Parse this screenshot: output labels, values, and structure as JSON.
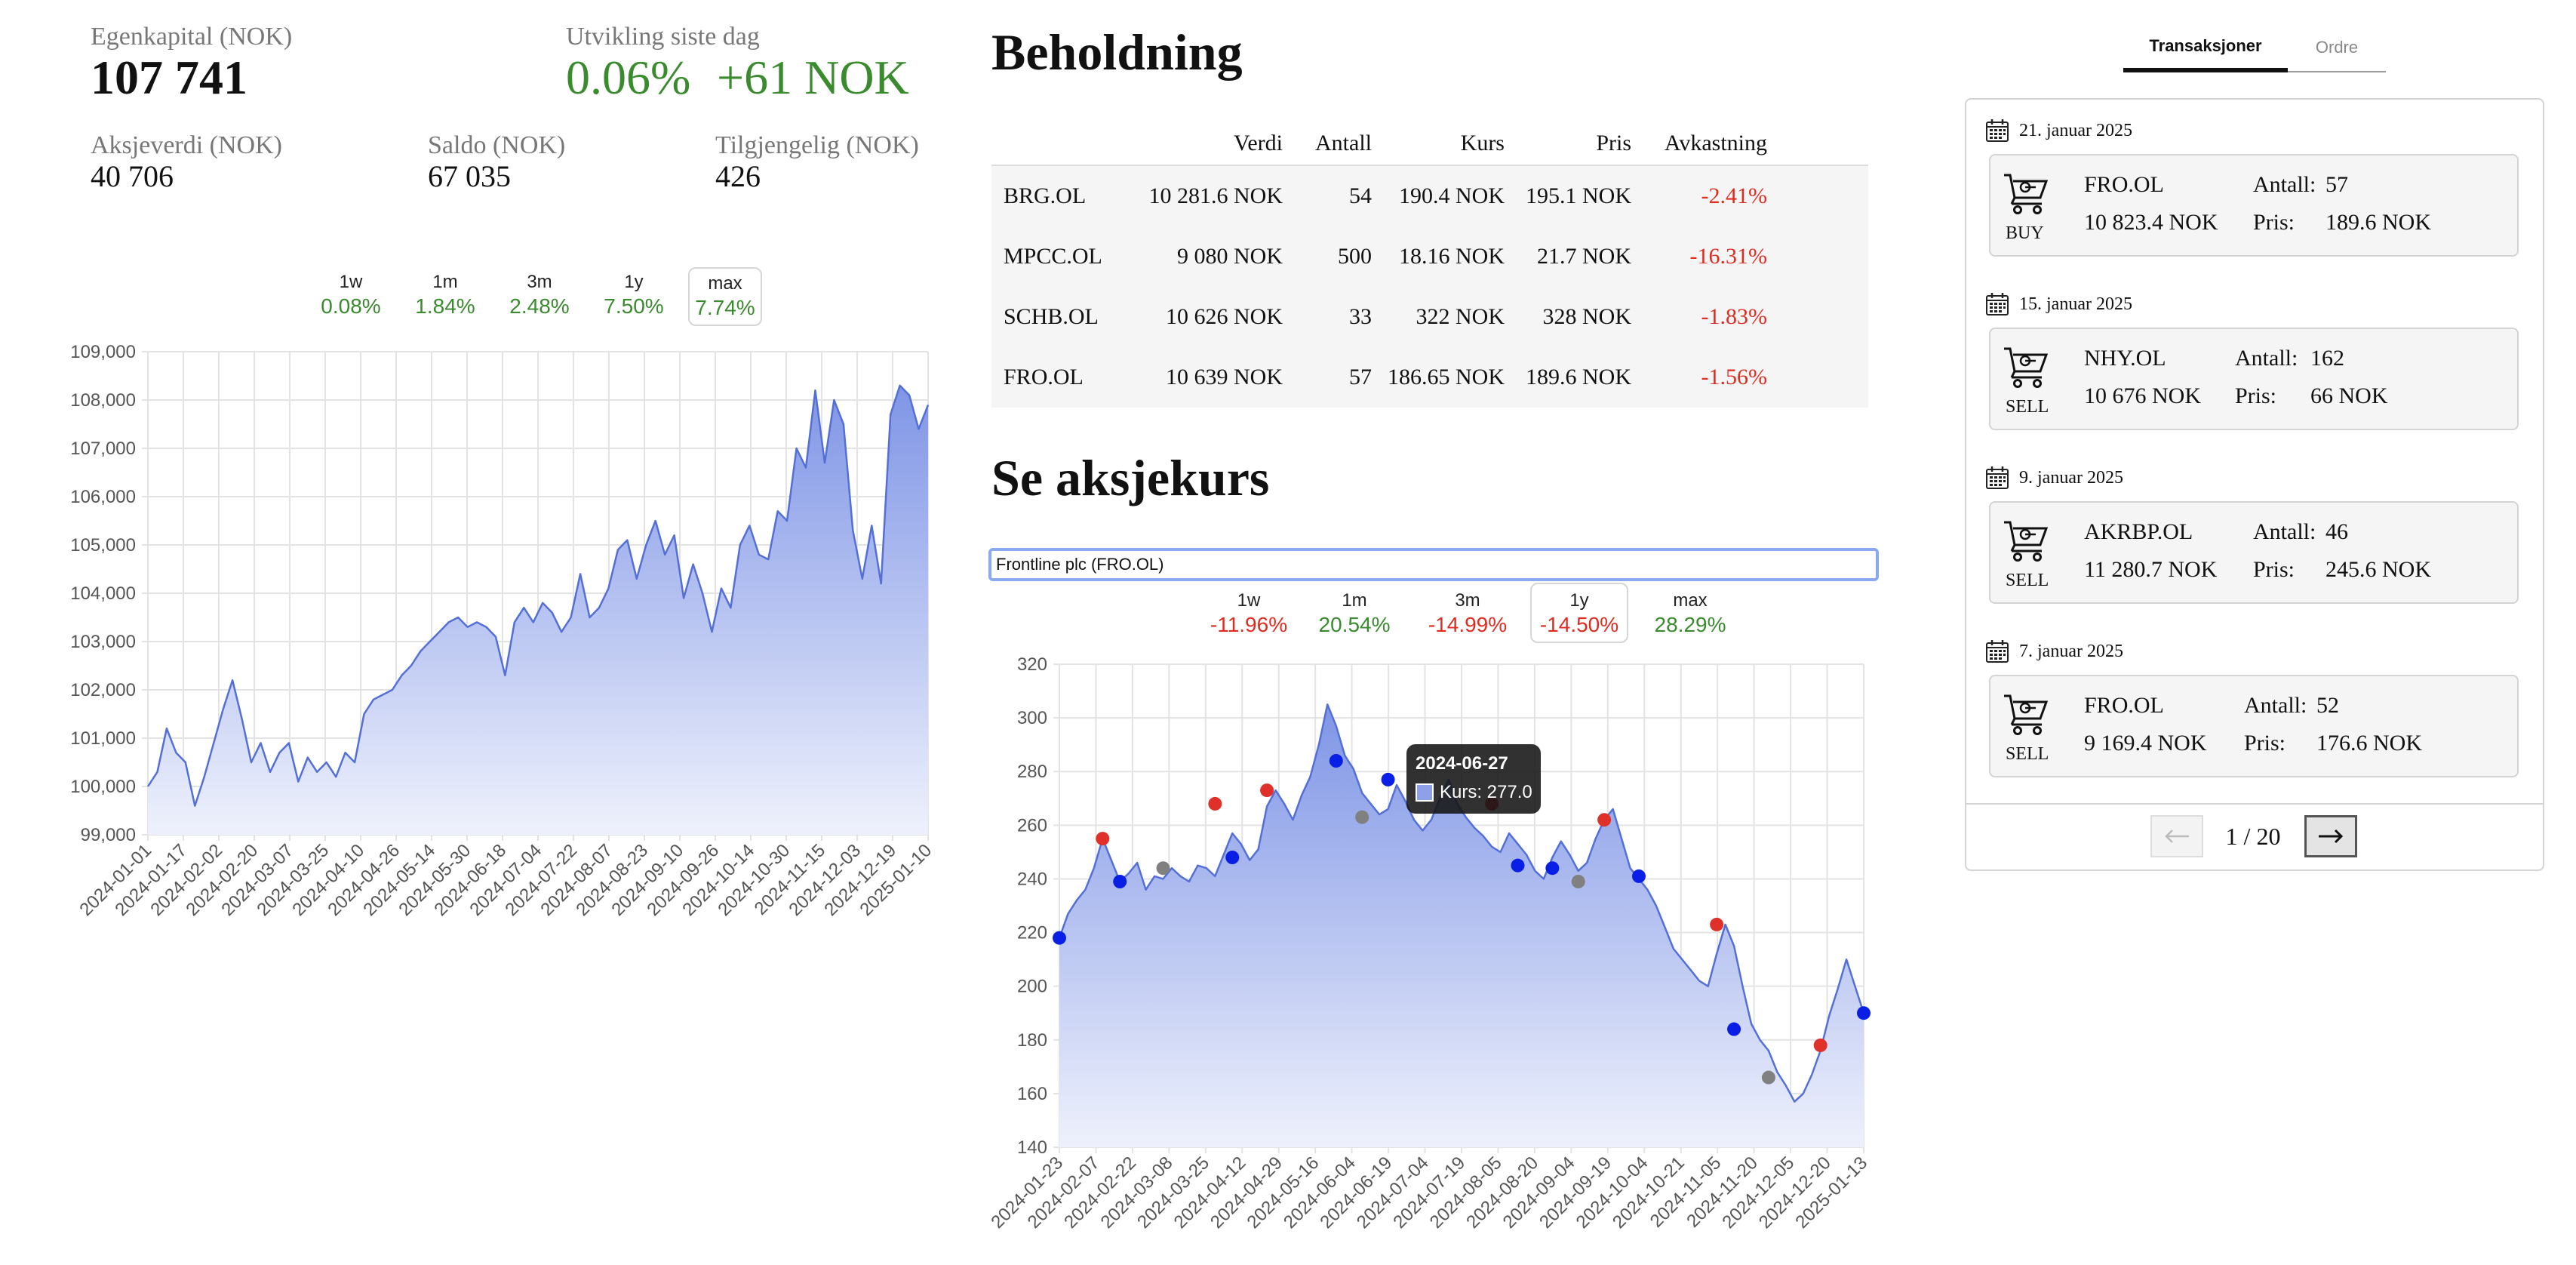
{
  "summary": {
    "equity_label": "Egenkapital (NOK)",
    "equity_value": "107 741",
    "dev_label": "Utvikling siste dag",
    "dev_pct": "0.06%",
    "dev_abs": "+61 NOK",
    "stock_value_label": "Aksjeverdi (NOK)",
    "stock_value": "40 706",
    "balance_label": "Saldo (NOK)",
    "balance_value": "67 035",
    "available_label": "Tilgjengelig (NOK)",
    "available_value": "426"
  },
  "portfolio_periods": [
    {
      "name": "1w",
      "value": "0.08%",
      "color": "green",
      "selected": false
    },
    {
      "name": "1m",
      "value": "1.84%",
      "color": "green",
      "selected": false
    },
    {
      "name": "3m",
      "value": "2.48%",
      "color": "green",
      "selected": false
    },
    {
      "name": "1y",
      "value": "7.50%",
      "color": "green",
      "selected": false
    },
    {
      "name": "max",
      "value": "7.74%",
      "color": "green",
      "selected": true
    }
  ],
  "holdings": {
    "title": "Beholdning",
    "headers": [
      "",
      "Verdi",
      "Antall",
      "Kurs",
      "Pris",
      "Avkastning"
    ],
    "rows": [
      [
        "BRG.OL",
        "10 281.6 NOK",
        "54",
        "190.4 NOK",
        "195.1 NOK",
        "-2.41%"
      ],
      [
        "MPCC.OL",
        "9 080 NOK",
        "500",
        "18.16 NOK",
        "21.7 NOK",
        "-16.31%"
      ],
      [
        "SCHB.OL",
        "10 626 NOK",
        "33",
        "322 NOK",
        "328 NOK",
        "-1.83%"
      ],
      [
        "FRO.OL",
        "10 639 NOK",
        "57",
        "186.65 NOK",
        "189.6 NOK",
        "-1.56%"
      ]
    ]
  },
  "stock_lookup": {
    "title": "Se aksjekurs",
    "input_value": "Frontline plc (FRO.OL)",
    "periods": [
      {
        "name": "1w",
        "value": "-11.96%",
        "color": "red",
        "selected": false
      },
      {
        "name": "1m",
        "value": "20.54%",
        "color": "green",
        "selected": false
      },
      {
        "name": "3m",
        "value": "-14.99%",
        "color": "red",
        "selected": false
      },
      {
        "name": "1y",
        "value": "-14.50%",
        "color": "red",
        "selected": true
      },
      {
        "name": "max",
        "value": "28.29%",
        "color": "green",
        "selected": false
      }
    ],
    "tooltip": {
      "date": "2024-06-27",
      "label": "Kurs: 277.0"
    }
  },
  "transactions": {
    "tabs": [
      {
        "label": "Transaksjoner",
        "active": true
      },
      {
        "label": "Ordre",
        "active": false
      }
    ],
    "items": [
      {
        "date": "21. januar 2025",
        "type": "BUY",
        "ticker": "FRO.OL",
        "amount": "10 823.4 NOK",
        "qty_label": "Antall:",
        "qty": "57",
        "price_label": "Pris:",
        "price": "189.6 NOK"
      },
      {
        "date": "15. januar 2025",
        "type": "SELL",
        "ticker": "NHY.OL",
        "amount": "10 676 NOK",
        "qty_label": "Antall:",
        "qty": "162",
        "price_label": "Pris:",
        "price": "66 NOK"
      },
      {
        "date": "9. januar 2025",
        "type": "SELL",
        "ticker": "AKRBP.OL",
        "amount": "11 280.7 NOK",
        "qty_label": "Antall:",
        "qty": "46",
        "price_label": "Pris:",
        "price": "245.6 NOK"
      },
      {
        "date": "7. januar 2025",
        "type": "SELL",
        "ticker": "FRO.OL",
        "amount": "9 169.4 NOK",
        "qty_label": "Antall:",
        "qty": "52",
        "price_label": "Pris:",
        "price": "176.6 NOK"
      }
    ],
    "pagination": {
      "prev_icon": "arrow-left-icon",
      "next_icon": "arrow-right-icon",
      "label": "1 / 20"
    }
  },
  "colors": {
    "line": "#5470d6",
    "fill_top": "#7f95e6",
    "fill_bottom": "#eef1fc",
    "green": "#3a8a2e",
    "red": "#e02b20",
    "marker_blue": "#0a1fe6",
    "marker_red": "#e0302a",
    "marker_grey": "#808080"
  },
  "chart_data": [
    {
      "type": "area",
      "title": "",
      "y_ticks": [
        "99,000",
        "100,000",
        "101,000",
        "102,000",
        "103,000",
        "104,000",
        "105,000",
        "106,000",
        "107,000",
        "108,000",
        "109,000"
      ],
      "ylim": [
        99000,
        109000
      ],
      "x_ticks": [
        "2024-01-01",
        "2024-01-17",
        "2024-02-02",
        "2024-02-20",
        "2024-03-07",
        "2024-03-25",
        "2024-04-10",
        "2024-04-26",
        "2024-05-14",
        "2024-05-30",
        "2024-06-18",
        "2024-07-04",
        "2024-07-22",
        "2024-08-07",
        "2024-08-23",
        "2024-09-10",
        "2024-09-26",
        "2024-10-14",
        "2024-10-30",
        "2024-11-15",
        "2024-12-03",
        "2024-12-19",
        "2025-01-10"
      ],
      "grid": true,
      "values": [
        100000,
        100300,
        101200,
        100700,
        100500,
        99600,
        100200,
        100900,
        101600,
        102200,
        101400,
        100500,
        100900,
        100300,
        100700,
        100900,
        100100,
        100600,
        100300,
        100500,
        100200,
        100700,
        100500,
        101500,
        101800,
        101900,
        102000,
        102300,
        102500,
        102800,
        103000,
        103200,
        103400,
        103500,
        103300,
        103400,
        103300,
        103100,
        102300,
        103400,
        103700,
        103400,
        103800,
        103600,
        103200,
        103500,
        104400,
        103500,
        103700,
        104100,
        104900,
        105100,
        104300,
        105000,
        105500,
        104800,
        105200,
        103900,
        104600,
        104000,
        103200,
        104100,
        103700,
        105000,
        105400,
        104800,
        104700,
        105700,
        105500,
        107000,
        106600,
        108200,
        106700,
        108000,
        107500,
        105300,
        104300,
        105400,
        104200,
        107700,
        108300,
        108100,
        107400,
        107900
      ]
    },
    {
      "type": "area",
      "title": "",
      "y_ticks": [
        "140",
        "160",
        "180",
        "200",
        "220",
        "240",
        "260",
        "280",
        "300",
        "320"
      ],
      "ylim": [
        140,
        320
      ],
      "x_ticks": [
        "2024-01-23",
        "2024-02-07",
        "2024-02-22",
        "2024-03-08",
        "2024-03-25",
        "2024-04-12",
        "2024-04-29",
        "2024-05-16",
        "2024-06-04",
        "2024-06-19",
        "2024-07-04",
        "2024-07-19",
        "2024-08-05",
        "2024-08-20",
        "2024-09-04",
        "2024-09-19",
        "2024-10-04",
        "2024-10-21",
        "2024-11-05",
        "2024-11-20",
        "2024-12-05",
        "2024-12-20",
        "2025-01-13"
      ],
      "grid": true,
      "series": [
        {
          "values": [
            218,
            227,
            232,
            236,
            244,
            255,
            247,
            239,
            242,
            246,
            236,
            241,
            240,
            244,
            241,
            239,
            245,
            244,
            241,
            249,
            257,
            253,
            247,
            251,
            267,
            273,
            268,
            262,
            271,
            278,
            290,
            305,
            297,
            286,
            281,
            272,
            268,
            264,
            266,
            275,
            269,
            262,
            258,
            262,
            270,
            277,
            268,
            263,
            259,
            256,
            252,
            250,
            257,
            253,
            249,
            243,
            240,
            248,
            254,
            249,
            243,
            246,
            255,
            262,
            266,
            255,
            244,
            240,
            236,
            230,
            222,
            214,
            210,
            206,
            202,
            200,
            212,
            223,
            215,
            200,
            186,
            180,
            176,
            168,
            163,
            157,
            160,
            167,
            176,
            189,
            199,
            210,
            200,
            190
          ]
        }
      ],
      "markers": [
        {
          "i": 0,
          "v": 218,
          "color": "blue"
        },
        {
          "i": 5,
          "v": 255,
          "color": "red"
        },
        {
          "i": 7,
          "v": 239,
          "color": "blue"
        },
        {
          "i": 12,
          "v": 244,
          "color": "grey"
        },
        {
          "i": 18,
          "v": 268,
          "color": "red"
        },
        {
          "i": 20,
          "v": 248,
          "color": "blue"
        },
        {
          "i": 24,
          "v": 273,
          "color": "red"
        },
        {
          "i": 32,
          "v": 284,
          "color": "blue"
        },
        {
          "i": 35,
          "v": 263,
          "color": "grey"
        },
        {
          "i": 38,
          "v": 277,
          "color": "blue"
        },
        {
          "i": 50,
          "v": 268,
          "color": "red"
        },
        {
          "i": 53,
          "v": 245,
          "color": "blue"
        },
        {
          "i": 57,
          "v": 244,
          "color": "blue"
        },
        {
          "i": 60,
          "v": 239,
          "color": "grey"
        },
        {
          "i": 63,
          "v": 262,
          "color": "red"
        },
        {
          "i": 67,
          "v": 241,
          "color": "blue"
        },
        {
          "i": 76,
          "v": 223,
          "color": "red"
        },
        {
          "i": 78,
          "v": 184,
          "color": "blue"
        },
        {
          "i": 82,
          "v": 166,
          "color": "grey"
        },
        {
          "i": 88,
          "v": 178,
          "color": "red"
        },
        {
          "i": 93,
          "v": 190,
          "color": "blue"
        }
      ]
    }
  ]
}
